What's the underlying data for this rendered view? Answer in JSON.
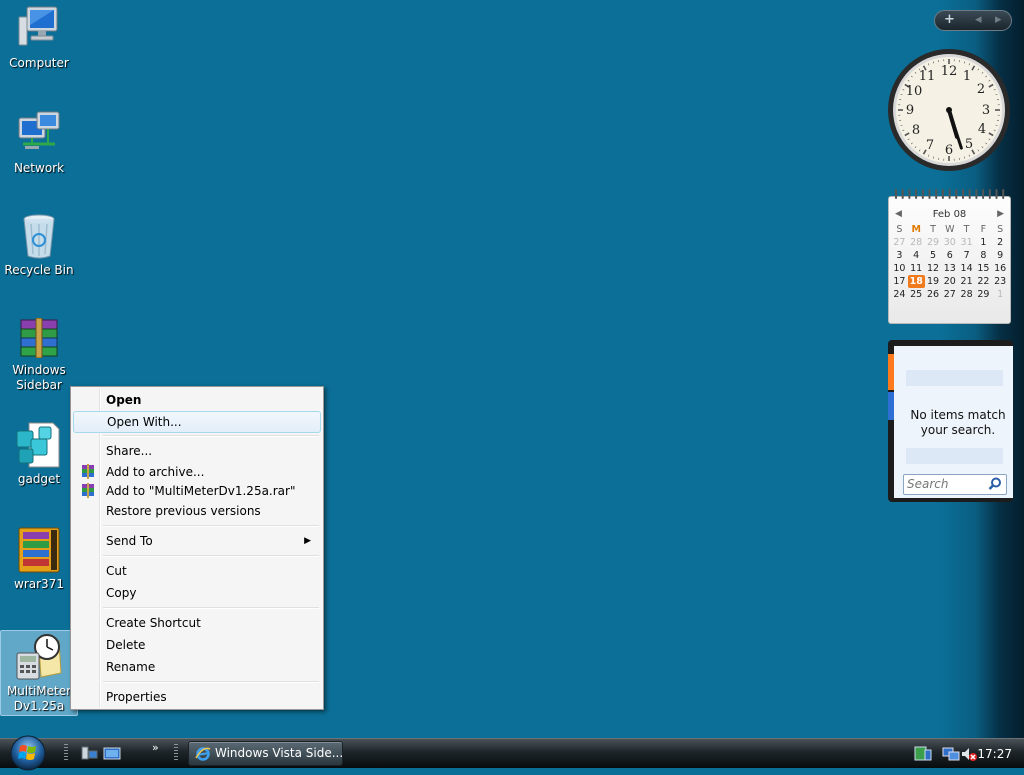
{
  "desktop_icons": [
    {
      "label": "Computer",
      "icon": "computer-icon"
    },
    {
      "label": "Network",
      "icon": "network-icon"
    },
    {
      "label": "Recycle Bin",
      "icon": "recycle-bin-icon"
    },
    {
      "label": "Windows Sidebar",
      "icon": "winrar-archive-icon"
    },
    {
      "label": "gadget",
      "icon": "gadget-file-icon"
    },
    {
      "label": "wrar371",
      "icon": "winrar-installer-icon"
    },
    {
      "label": "MultiMeterDv1.25a",
      "icon": "multimeter-gadget-icon"
    }
  ],
  "context_menu": {
    "open": "Open",
    "open_with": "Open With...",
    "share": "Share...",
    "add_archive": "Add to archive...",
    "add_rar": "Add to \"MultiMeterDv1.25a.rar\"",
    "restore": "Restore previous versions",
    "send_to": "Send To",
    "cut": "Cut",
    "copy": "Copy",
    "create_shortcut": "Create Shortcut",
    "delete": "Delete",
    "rename": "Rename",
    "properties": "Properties"
  },
  "sidebar": {
    "controls": [
      "+",
      "◂",
      "▸"
    ],
    "clock": {
      "hour": 5,
      "minute": 27
    },
    "calendar": {
      "month": "Feb 08",
      "weekdays": [
        "S",
        "M",
        "T",
        "W",
        "T",
        "F",
        "S"
      ],
      "weeks": [
        [
          "27",
          "28",
          "29",
          "30",
          "31",
          "1",
          "2"
        ],
        [
          "3",
          "4",
          "5",
          "6",
          "7",
          "8",
          "9"
        ],
        [
          "10",
          "11",
          "12",
          "13",
          "14",
          "15",
          "16"
        ],
        [
          "17",
          "18",
          "19",
          "20",
          "21",
          "22",
          "23"
        ],
        [
          "24",
          "25",
          "26",
          "27",
          "28",
          "29",
          "1"
        ]
      ],
      "today": "18"
    },
    "feed": {
      "message": "No items match your search.",
      "search_placeholder": "Search"
    }
  },
  "taskbar": {
    "task_button": "Windows Vista Side...",
    "time": "17:27",
    "quick_launch_chevron": "»"
  },
  "colors": {
    "desktop": "#0b6f97",
    "accent_orange": "#f07a1c"
  }
}
